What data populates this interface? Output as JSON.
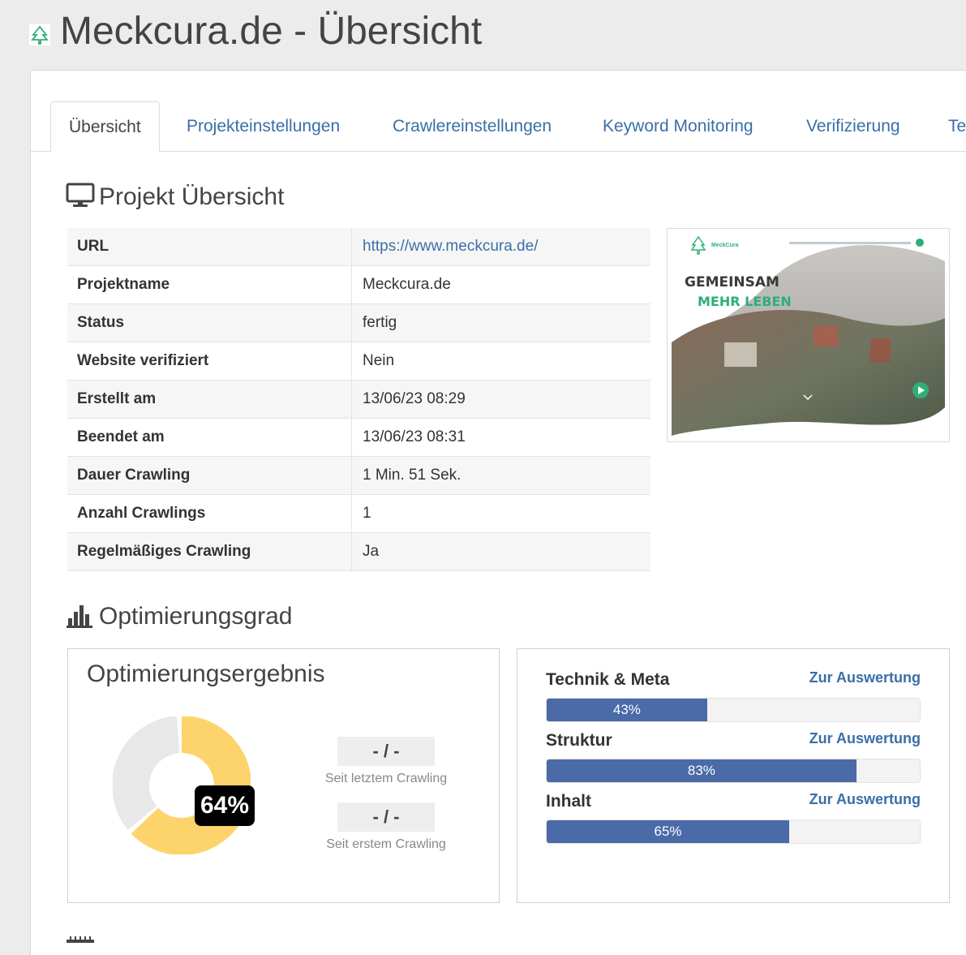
{
  "header": {
    "title": "Meckcura.de - Übersicht",
    "logo_icon": "meckcura-tree-logo-icon"
  },
  "tabs": [
    {
      "label": "Übersicht",
      "active": true
    },
    {
      "label": "Projekteinstellungen",
      "active": false
    },
    {
      "label": "Crawlereinstellungen",
      "active": false
    },
    {
      "label": "Keyword Monitoring",
      "active": false
    },
    {
      "label": "Verifizierung",
      "active": false
    },
    {
      "label": "Te",
      "active": false
    }
  ],
  "overview": {
    "title": "Projekt Übersicht",
    "icon": "monitor-icon",
    "rows": [
      {
        "label": "URL",
        "value": "https://www.meckcura.de/",
        "link": true
      },
      {
        "label": "Projektname",
        "value": "Meckcura.de"
      },
      {
        "label": "Status",
        "value": "fertig"
      },
      {
        "label": "Website verifiziert",
        "value": "Nein"
      },
      {
        "label": "Erstellt am",
        "value": "13/06/23 08:29"
      },
      {
        "label": "Beendet am",
        "value": "13/06/23 08:31"
      },
      {
        "label": "Dauer Crawling",
        "value": "1 Min. 51 Sek."
      },
      {
        "label": "Anzahl Crawlings",
        "value": "1"
      },
      {
        "label": "Regelmäßiges Crawling",
        "value": "Ja"
      }
    ]
  },
  "thumbnail": {
    "line1": "GEMEINSAM",
    "line2": "MEHR LEBEN",
    "brand": "MeckCura"
  },
  "optimization": {
    "title": "Optimierungsgrad",
    "icon": "bar-chart-icon",
    "result_card": {
      "title": "Optimierungsergebnis",
      "percent_label": "64%",
      "percent_value": 64,
      "since_last_value": "- / -",
      "since_last_caption": "Seit letztem Crawling",
      "since_first_value": "- / -",
      "since_first_caption": "Seit erstem Crawling"
    },
    "metrics": [
      {
        "label": "Technik & Meta",
        "link": "Zur Auswertung",
        "value": 43,
        "value_label": "43%"
      },
      {
        "label": "Struktur",
        "link": "Zur Auswertung",
        "value": 83,
        "value_label": "83%"
      },
      {
        "label": "Inhalt",
        "link": "Zur Auswertung",
        "value": 65,
        "value_label": "65%"
      }
    ]
  },
  "colors": {
    "accent_blue": "#3a6fa7",
    "bar_blue": "#4a6aa8",
    "donut_yellow": "#fdd36b",
    "donut_grey": "#e8e8e8",
    "brand_green": "#2fae7a"
  }
}
